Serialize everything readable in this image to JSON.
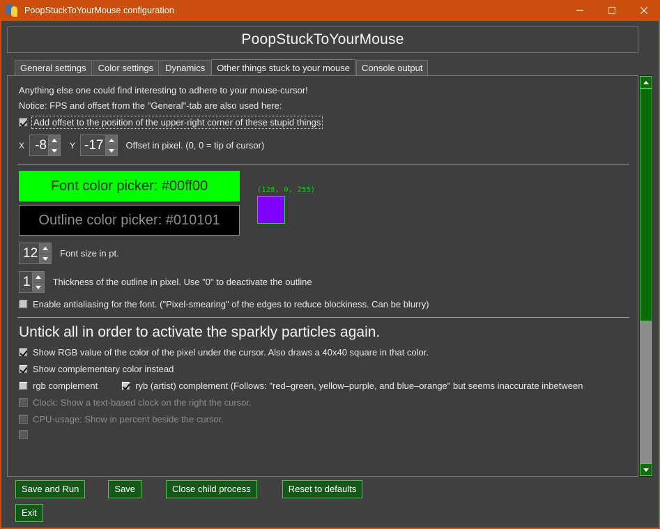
{
  "window": {
    "title": "PoopStuckToYourMouse configuration",
    "icon": "python-logo-icon",
    "titlebar_color": "#cb500d",
    "minimize_label": "─",
    "maximize_label": "□",
    "close_label": "✕"
  },
  "banner": {
    "title": "PoopStuckToYourMouse"
  },
  "tabs": [
    {
      "label": "General settings",
      "active": false
    },
    {
      "label": "Color settings",
      "active": false
    },
    {
      "label": "Dynamics",
      "active": false
    },
    {
      "label": "Other things stuck to your mouse",
      "active": true
    },
    {
      "label": "Console output",
      "active": false
    }
  ],
  "content": {
    "intro_line_1": "Anything else one could find interesting to adhere to your mouse-cursor!",
    "intro_line_2": "Notice: FPS and offset from the \"General\"-tab are also used here:",
    "offset_checkbox": {
      "label": "Add offset to the position of the upper-right corner of these stupid things",
      "checked": true,
      "focused": true
    },
    "offset": {
      "x_label": "X",
      "x_value": "-8",
      "y_label": "Y",
      "y_value": "-17",
      "note": "Offset in pixel. (0, 0 = tip of cursor)"
    },
    "font_color_picker": {
      "label": "Font color picker: #00ff00",
      "color": "#00ff00",
      "text_color": "#2a2a2a"
    },
    "outline_color_picker": {
      "label": "Outline color picker: #010101",
      "color": "#010101",
      "text_color": "#8f8f8f"
    },
    "preview_swatch": {
      "rgb_label": "(128, 0, 255)",
      "color": "#8000ff",
      "border_color": "#2bd52b",
      "label_color": "#00e000"
    },
    "font_size": {
      "value": "12",
      "note": "Font size in pt."
    },
    "outline_thickness": {
      "value": "1",
      "note": "Thickness of the outline in pixel. Use \"0\" to deactivate the outline"
    },
    "antialiasing_checkbox": {
      "label": "Enable antialiasing for the font. (\"Pixel-smearing\" of the edges to reduce blockiness. Can be blurry)",
      "checked": false
    },
    "section_heading": "Untick all in order to activate the sparkly particles again.",
    "checkboxes": [
      {
        "label": "Show RGB value of the color of the pixel under the cursor. Also draws a 40x40 square in that color.",
        "checked": true,
        "disabled": false
      },
      {
        "label": "Show complementary color instead",
        "checked": true,
        "disabled": false
      }
    ],
    "complement_row": {
      "rgb": {
        "label": "rgb complement",
        "checked": false,
        "disabled": false
      },
      "ryb": {
        "label": "ryb (artist) complement (Follows: \"red–green, yellow–purple, and blue–orange\" but seems inaccurate inbetween",
        "checked": true,
        "disabled": false
      }
    },
    "disabled_checkboxes": [
      {
        "label": "Clock: Show a text-based clock on the right the cursor.",
        "checked": false,
        "disabled": true
      },
      {
        "label": "CPU-usage: Show in percent beside the cursor.",
        "checked": false,
        "disabled": true
      }
    ]
  },
  "scrollbar": {
    "up_arrow": "scroll-up-arrow-icon",
    "down_arrow": "scroll-down-arrow-icon",
    "thumb_color": "#0a6b0a",
    "track_color": "#8c8c8c"
  },
  "buttons": {
    "save_and_run": "Save and Run",
    "save": "Save",
    "close_child_process": "Close child process",
    "reset_to_defaults": "Reset to defaults",
    "exit": "Exit",
    "color": "#14591a",
    "border_color": "#4ec24e"
  }
}
